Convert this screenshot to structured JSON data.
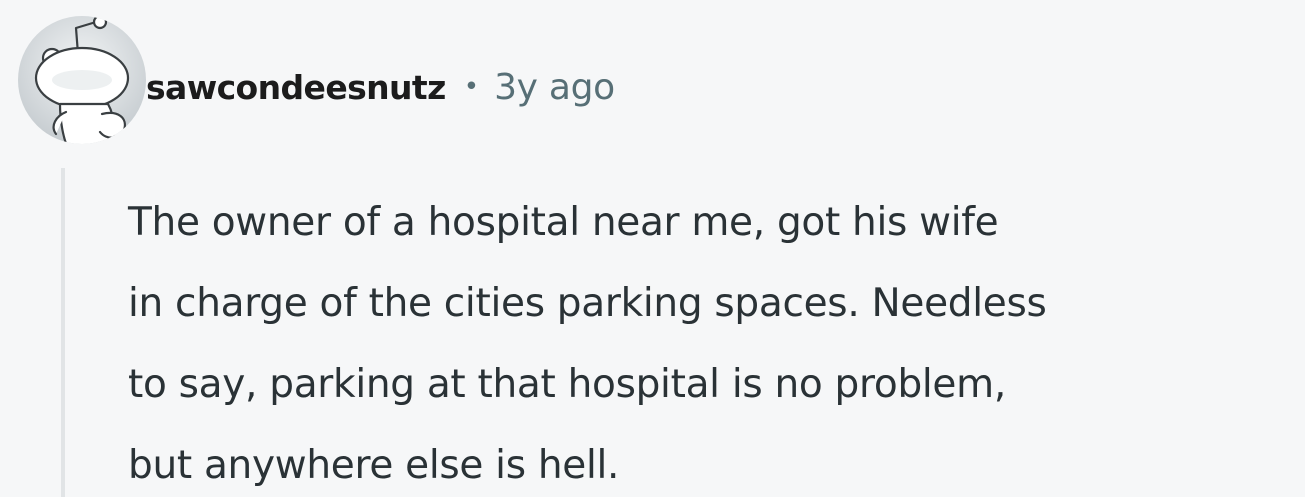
{
  "comment": {
    "author": "sawcondeesnutz",
    "separator": "•",
    "timestamp": "3y ago",
    "avatar_icon": "reddit-snoo-default-avatar-icon",
    "body_lines": [
      "The owner of a hospital near me, got his wife",
      "in charge of the cities parking spaces. Needless",
      "to say, parking at that hospital is no problem,",
      "but anywhere else is hell."
    ]
  },
  "colors": {
    "background": "#f6f7f8",
    "username": "#1c1c1c",
    "meta": "#576f76",
    "body_text": "#2a3236",
    "thread_line": "#e1e4e6",
    "avatar_bg": "#d0d5d8"
  }
}
